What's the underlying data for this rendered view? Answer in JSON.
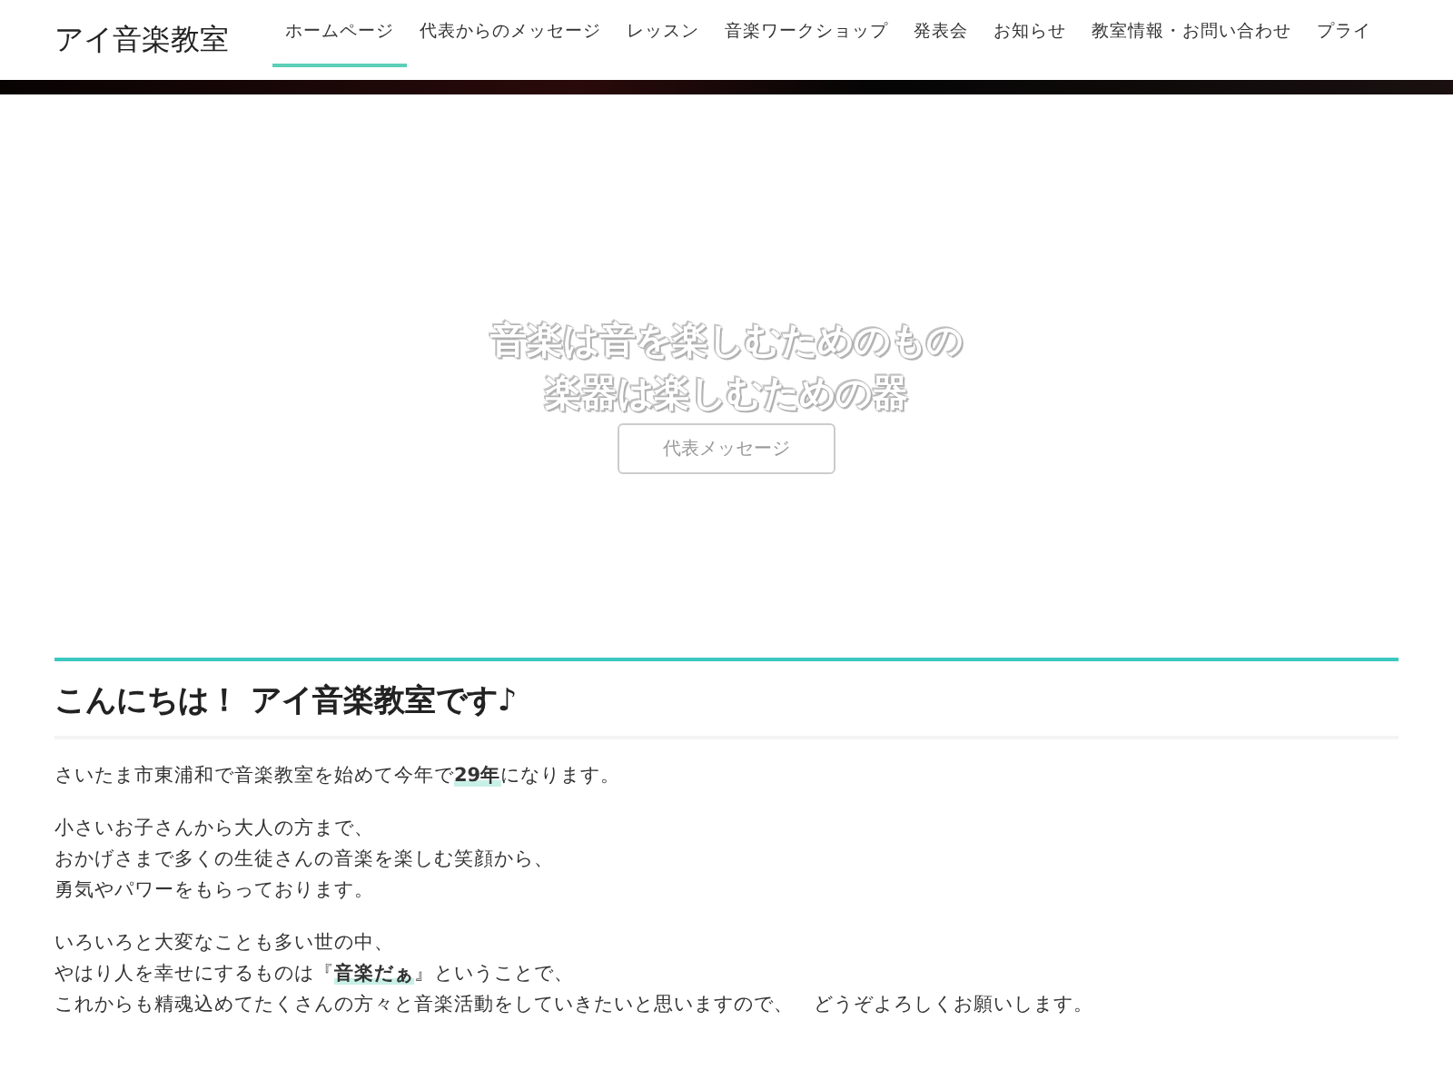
{
  "site_title": "アイ音楽教室",
  "nav": [
    {
      "label": "ホームページ",
      "selected": true
    },
    {
      "label": "代表からのメッセージ",
      "selected": false
    },
    {
      "label": "レッスン",
      "selected": false
    },
    {
      "label": "音楽ワークショップ",
      "selected": false
    },
    {
      "label": "発表会",
      "selected": false
    },
    {
      "label": "お知らせ",
      "selected": false
    },
    {
      "label": "教室情報・お問い合わせ",
      "selected": false
    },
    {
      "label": "プライ",
      "selected": false
    }
  ],
  "hero": {
    "lines": [
      "音楽は音を楽しむためのもの",
      "楽器は楽しむための器"
    ],
    "button": "代表メッセージ"
  },
  "section": {
    "heading": "こんにちは！ アイ音楽教室です♪",
    "paragraphs": [
      [
        "さいたま市東浦和で音楽教室を始めて今年で**29年**になります。"
      ],
      [
        "小さいお子さんから大人の方まで、",
        "おかげさまで多くの生徒さんの音楽を楽しむ笑顔から、",
        "勇気やパワーをもらっております。"
      ],
      [
        "いろいろと大変なことも多い世の中、",
        "やはり人を幸せにするものは『**音楽だぁ**』ということで、",
        "これからも精魂込めてたくさんの方々と音楽活動をしていきたいと思いますので、　どうぞよろしくお願いします。"
      ]
    ]
  }
}
